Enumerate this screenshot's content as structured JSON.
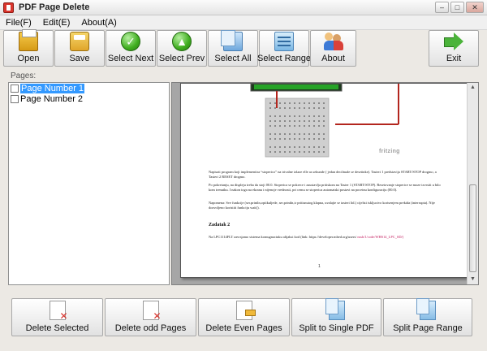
{
  "window": {
    "title": "PDF Page Delete",
    "controls": {
      "minimize": "–",
      "maximize": "□",
      "close": "✕"
    }
  },
  "menu": {
    "items": [
      "File(F)",
      "Edit(E)",
      "About(A)"
    ]
  },
  "toolbar": {
    "open": "Open",
    "save": "Save",
    "select_next": "Select Next",
    "select_prev": "Select Prev",
    "select_all": "Select All",
    "select_range": "Select Range",
    "about": "About",
    "exit": "Exit",
    "icons": {
      "select_next_glyph": "✓",
      "select_prev_glyph": "▲"
    }
  },
  "pages_panel": {
    "label": "Pages:",
    "items": [
      {
        "label": "Page Number 1",
        "checked": false,
        "selected": true
      },
      {
        "label": "Page Number 2",
        "checked": false,
        "selected": false
      }
    ]
  },
  "preview": {
    "diagram_label": "fritzing",
    "paragraph1": "Napisati program koji implementira “stoperico” na trivalne izlaze elle as sekunde ( jedan decilmale se desetinke). Tasteri 1 predstavija START/STOP drogmo, a Tasteri 2 RESET drogmo.",
    "paragraph2": "Po pokretanju, na displeju treba da stoji 00.0. Stoperica se pokrece i zaustavlja pritiskom na Taster 1 (START/STOP). Resetovanje stoperice se moze izvrsiti u bilo kom trenutku. I nakon toga na ekranu i nijenoje vrednosti, pri cemu se stoperica automatski postavi na pocetnu konfiguraciju (00.0).",
    "paragraph3": "Napomena: Sve funkcije (ser.println,optikuljede, ser.println,tr pritisnutog klapna, uvalajte se tasteri ltd.) cijelsti iskljucivo korisenjem prekida (interrupta). Nije dozvoljeno koristiti funkciju wait().",
    "heading": "Zadatak 2",
    "paragraph4": "Na LPC1114FLT zavrsjamo sistema komugnaciuku alijaksi kod (link: https://developer.mbed.org/users/",
    "link": "nssh/1/code/WHS14_LPC_SD/)",
    "page_number": "1"
  },
  "actions": {
    "delete_selected": "Delete Selected",
    "delete_odd": "Delete odd Pages",
    "delete_even": "Delete Even Pages",
    "split_single": "Split to Single PDF",
    "split_range": "Split Page Range"
  }
}
